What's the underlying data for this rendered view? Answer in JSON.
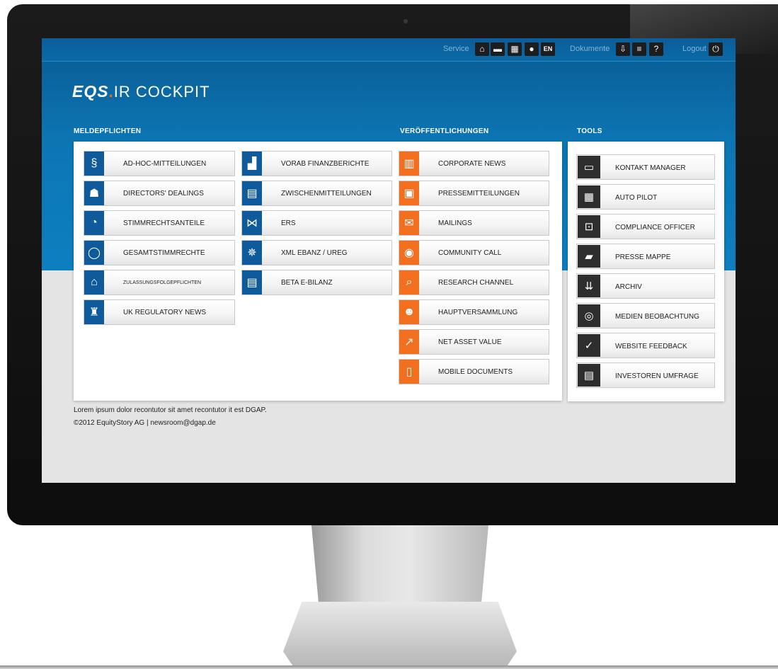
{
  "topbar": {
    "service_label": "Service",
    "service_icons": [
      {
        "icon": "home-icon",
        "glyph": "⌂"
      },
      {
        "icon": "card-icon",
        "glyph": "▬"
      },
      {
        "icon": "building-icon",
        "glyph": "▦"
      },
      {
        "icon": "user-icon",
        "glyph": "●"
      }
    ],
    "lang": "EN",
    "documents_label": "Dokumente",
    "document_icons": [
      {
        "icon": "download-icon",
        "glyph": "⇩"
      },
      {
        "icon": "list-icon",
        "glyph": "≡"
      },
      {
        "icon": "help-icon",
        "glyph": "?"
      }
    ],
    "logout_label": "Logout",
    "logout_glyph": "⏻"
  },
  "logo": {
    "brand": "EQS",
    "separator": ".",
    "product": "IR COCKPIT"
  },
  "sections": {
    "meldepflichten": "MELDEPFLICHTEN",
    "veroeffentlichungen": "VERÖFFENTLICHUNGEN",
    "tools": "TOOLS"
  },
  "meldepflichten_col1": [
    {
      "label": "AD-HOC-MITTEILUNGEN",
      "icon": "paragraph-icon",
      "glyph": "§"
    },
    {
      "label": "DIRECTORS' DEALINGS",
      "icon": "person-icon",
      "glyph": "☗"
    },
    {
      "label": "STIMMRECHTSANTEILE",
      "icon": "pie-chart-icon",
      "glyph": "◔"
    },
    {
      "label": "GESAMTSTIMMRECHTE",
      "icon": "circle-icon",
      "glyph": "◯"
    },
    {
      "label": "ZULASSUNGSFOLGEPFLICHTEN",
      "icon": "institution-icon",
      "glyph": "⌂",
      "small": true
    },
    {
      "label": "UK REGULATORY NEWS",
      "icon": "big-ben-icon",
      "glyph": "♜"
    }
  ],
  "meldepflichten_col2": [
    {
      "label": "VORAB FINANZBERICHTE",
      "icon": "bar-chart-icon",
      "glyph": "▟"
    },
    {
      "label": "ZWISCHENMITTEILUNGEN",
      "icon": "document-icon",
      "glyph": "▤"
    },
    {
      "label": "ERS",
      "icon": "bowtie-icon",
      "glyph": "⋈"
    },
    {
      "label": "XML EBANZ / UREG",
      "icon": "eagle-icon",
      "glyph": "✵"
    },
    {
      "label": "BETA E-BILANZ",
      "icon": "ledger-icon",
      "glyph": "▤"
    }
  ],
  "veroeffentlichungen": [
    {
      "label": "CORPORATE NEWS",
      "icon": "buildings-icon",
      "glyph": "▥"
    },
    {
      "label": "PRESSEMITTEILUNGEN",
      "icon": "news-icon",
      "glyph": "▣"
    },
    {
      "label": "MAILINGS",
      "icon": "mail-icon",
      "glyph": "✉"
    },
    {
      "label": "COMMUNITY CALL",
      "icon": "broadcast-icon",
      "glyph": "◉"
    },
    {
      "label": "RESEARCH CHANNEL",
      "icon": "search-document-icon",
      "glyph": "⌕"
    },
    {
      "label": "HAUPTVERSAMMLUNG",
      "icon": "audience-icon",
      "glyph": "☻"
    },
    {
      "label": "NET ASSET VALUE",
      "icon": "trend-line-icon",
      "glyph": "↗"
    },
    {
      "label": "MOBILE DOCUMENTS",
      "icon": "mobile-icon",
      "glyph": "▯"
    }
  ],
  "tools": [
    {
      "label": "KONTAKT MANAGER",
      "icon": "contact-card-icon",
      "glyph": "▭"
    },
    {
      "label": "AUTO PILOT",
      "icon": "calendar-icon",
      "glyph": "▦"
    },
    {
      "label": "COMPLIANCE OFFICER",
      "icon": "lock-folder-icon",
      "glyph": "⊡"
    },
    {
      "label": "PRESSE MAPPE",
      "icon": "folder-icon",
      "glyph": "▰"
    },
    {
      "label": "ARCHIV",
      "icon": "archive-download-icon",
      "glyph": "⇊"
    },
    {
      "label": "MEDIEN BEOBACHTUNG",
      "icon": "globe-search-icon",
      "glyph": "◎"
    },
    {
      "label": "WEBSITE FEEDBACK",
      "icon": "feedback-icon",
      "glyph": "✓"
    },
    {
      "label": "INVESTOREN UMFRAGE",
      "icon": "clipboard-icon",
      "glyph": "▤"
    }
  ],
  "footer": {
    "line1": "Lorem ipsum dolor recontutor sit amet recontutor it est DGAP.",
    "line2": "©2012 EquityStory AG  |  newsroom@dgap.de"
  }
}
